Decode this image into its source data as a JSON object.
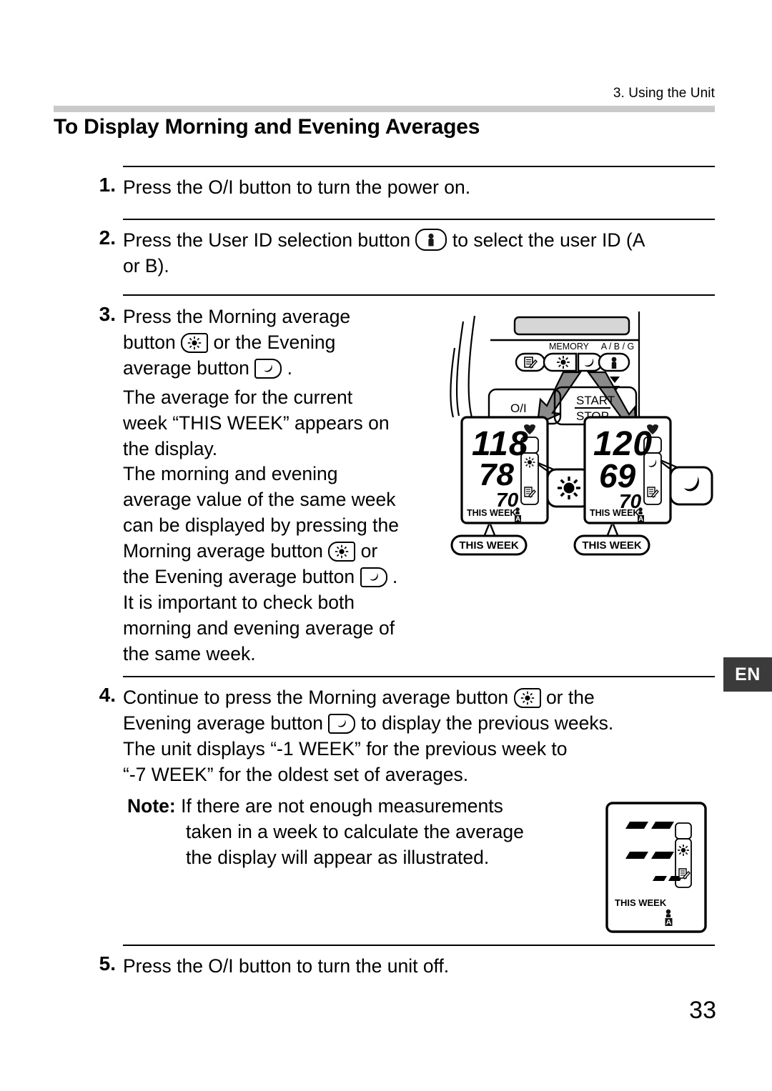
{
  "header": {
    "chapter": "3. Using the Unit",
    "bar_color": "#c9c9c9"
  },
  "title": "To Display Morning and Evening Averages",
  "language_tab": {
    "label": "EN",
    "bg": "#3b3b3b",
    "fg": "#ffffff"
  },
  "page_number": "33",
  "steps": [
    {
      "number": "1.",
      "lines": [
        "Press the O/I button to turn the power on."
      ]
    },
    {
      "number": "2.",
      "line_a": "Press the User ID selection button",
      "line_b": "to select the user ID (A",
      "line_c": "or B)."
    },
    {
      "number": "3.",
      "l1a": "Press the Morning average",
      "l2a": "button",
      "l2b": "or the Evening",
      "l3a": "average button",
      "l3b": ".",
      "para1": [
        "The average for the current",
        "week “THIS WEEK” appears on",
        "the display."
      ],
      "para2_l1": "The morning and evening",
      "para2_l2": "average value of the same week",
      "para2_l3": "can be displayed by pressing the",
      "para2_l4a": "Morning average button",
      "para2_l4b": "or",
      "para2_l5a": "the Evening average button",
      "para2_l5b": ".",
      "para2_l6": "It is important to check both",
      "para2_l7": "morning and evening average of",
      "para2_l8": "the same week."
    },
    {
      "number": "4.",
      "l1a": "Continue to press the Morning average button",
      "l1b": "or the",
      "l2a": "Evening average button",
      "l2b": "to display the previous weeks.",
      "l3": "The unit displays “-1 WEEK” for the previous week to",
      "l4": "“-7 WEEK” for the oldest set of averages.",
      "note_label": "Note:",
      "note_lines": [
        "If there are not enough measurements",
        "taken in a week to calculate the average",
        "the display will appear as illustrated."
      ]
    },
    {
      "number": "5.",
      "lines": [
        "Press the O/I button to turn the unit off."
      ]
    }
  ],
  "figure_device": {
    "panel_labels": {
      "memory": "MEMORY",
      "abg": "A / B / G"
    },
    "power_button": "O/I",
    "start_label": "START",
    "stop_label": "STOP",
    "buttons": [
      "memory-note-icon",
      "sun-icon",
      "moon-icon",
      "user-id-icon"
    ],
    "callout_left": "THIS WEEK",
    "callout_right": "THIS WEEK",
    "lcd_left": {
      "systolic": "118",
      "diastolic": "78",
      "pulse": "70",
      "week_label": "THIS WEEK",
      "user_id": "A",
      "indicator": "sun-icon",
      "magnified_icon": "sun-icon"
    },
    "lcd_right": {
      "systolic": "120",
      "diastolic": "69",
      "pulse": "70",
      "week_label": "THIS WEEK",
      "user_id": "A",
      "indicator": "moon-icon",
      "magnified_icon": "moon-icon"
    }
  },
  "figure_note_lcd": {
    "systolic": "--",
    "diastolic": "--",
    "pulse": "--",
    "week_label": "THIS WEEK",
    "user_id": "A",
    "indicator": "sun-icon"
  }
}
